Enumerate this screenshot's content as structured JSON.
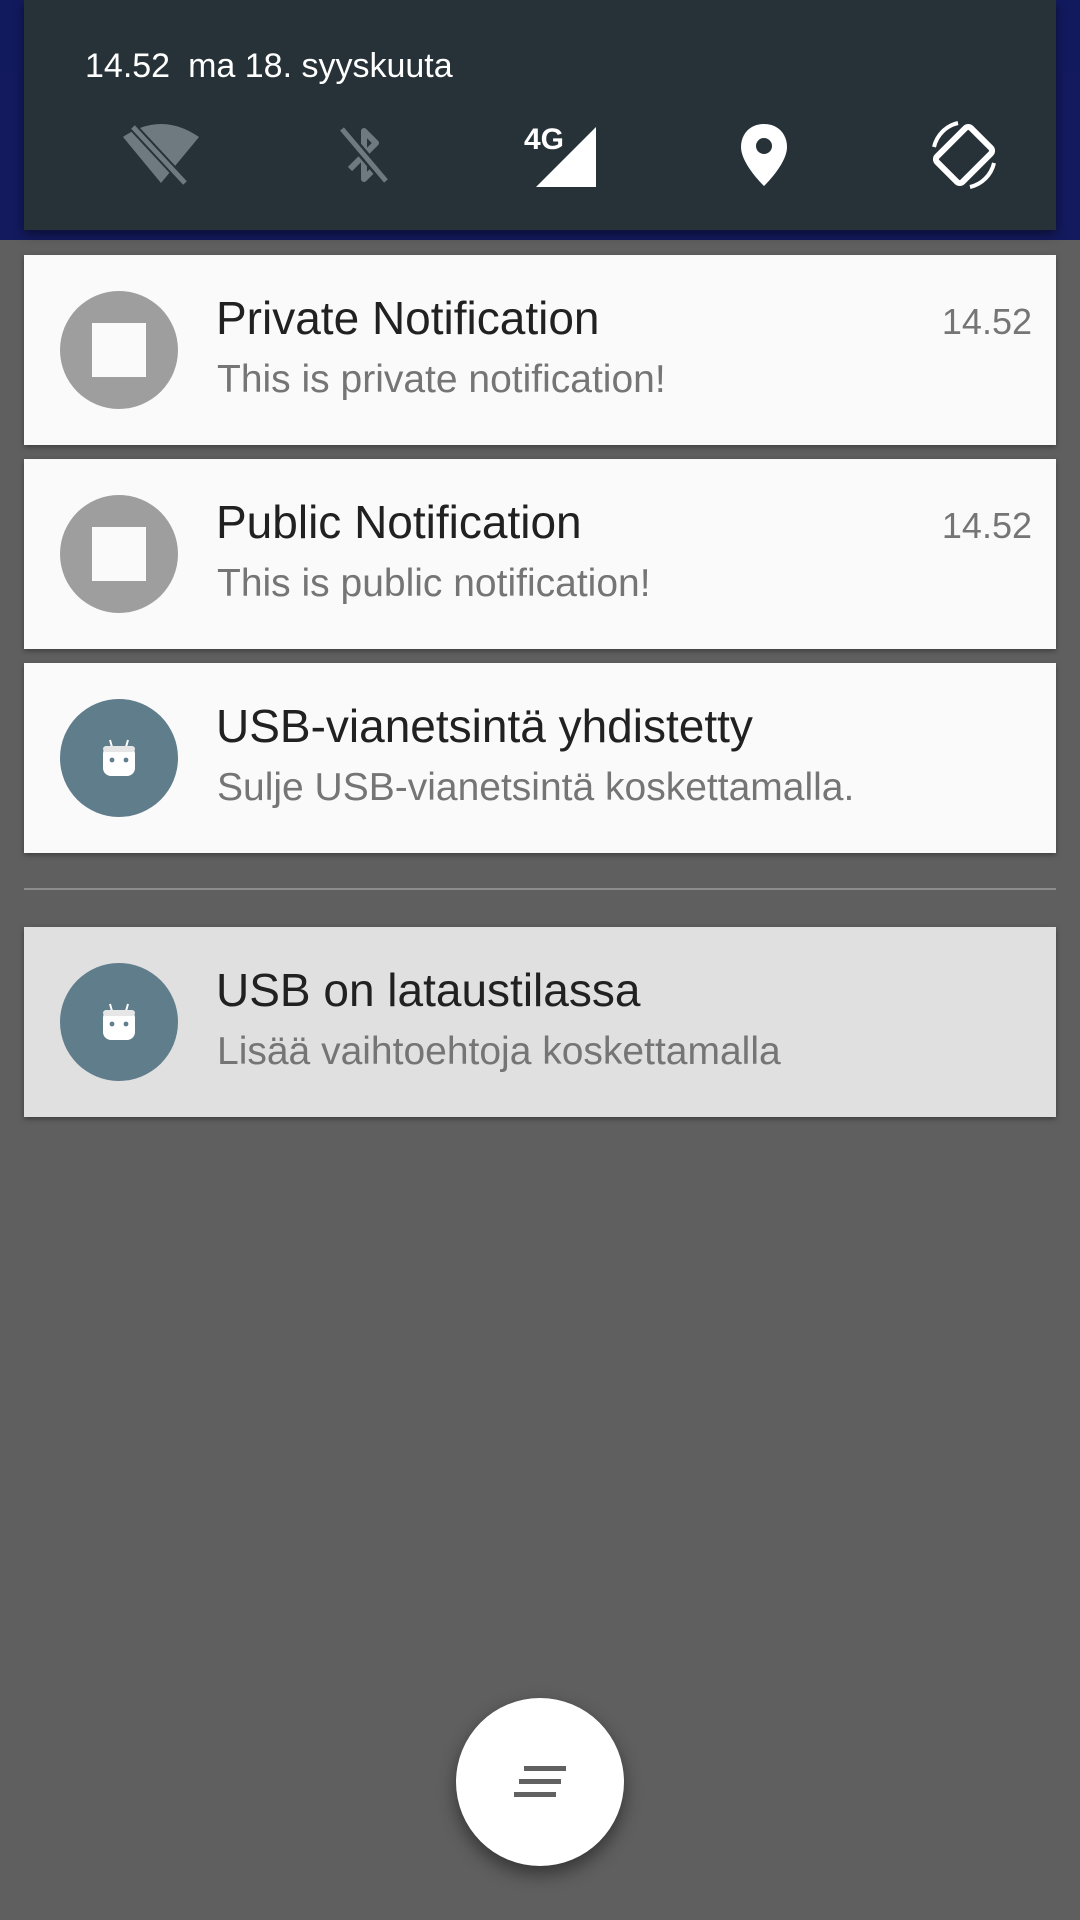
{
  "status_header": {
    "time": "14.52",
    "date": "ma 18. syyskuuta",
    "network_label": "4G"
  },
  "quick_settings": [
    {
      "icon": "wifi-off-icon",
      "active": false
    },
    {
      "icon": "bluetooth-off-icon",
      "active": false
    },
    {
      "icon": "cellular-signal-icon",
      "active": true
    },
    {
      "icon": "location-icon",
      "active": true
    },
    {
      "icon": "auto-rotate-icon",
      "active": true
    }
  ],
  "notifications": [
    {
      "title": "Private Notification",
      "text": "This is private notification!",
      "time": "14.52",
      "icon": "stop-icon"
    },
    {
      "title": "Public Notification",
      "text": "This is public notification!",
      "time": "14.52",
      "icon": "stop-icon"
    },
    {
      "title": "USB-vianetsintä yhdistetty",
      "text": "Sulje USB-vianetsintä koskettamalla.",
      "icon": "android-icon"
    }
  ],
  "ongoing_notification": {
    "title": "USB on lataustilassa",
    "text": "Lisää vaihtoehtoja koskettamalla",
    "icon": "android-icon"
  },
  "clear_all": {
    "icon": "clear-all-icon"
  },
  "colors": {
    "qs_background": "#263238",
    "card_background": "#fafafa",
    "ongoing_background": "#e0e0e0",
    "avatar_gray": "#9e9e9e",
    "avatar_slate": "#607d8b",
    "shade_background": "#5f5f5f"
  }
}
